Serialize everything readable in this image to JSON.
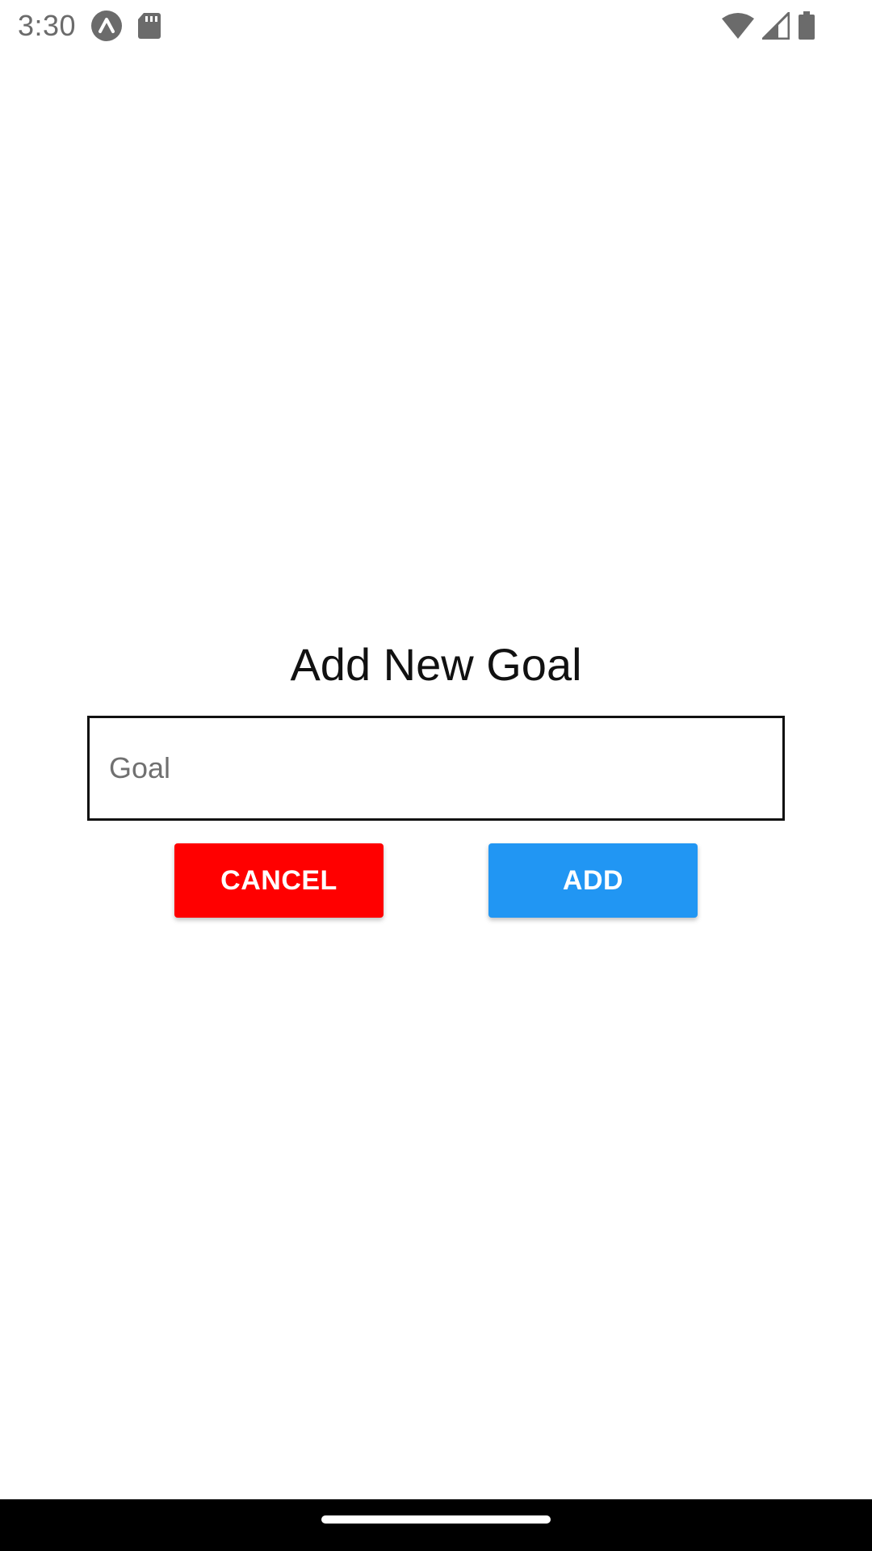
{
  "status_bar": {
    "time": "3:30",
    "icons": [
      "app-notification-icon",
      "sd-card-icon",
      "wifi-icon",
      "cell-signal-icon",
      "battery-icon"
    ]
  },
  "dialog": {
    "title": "Add New Goal",
    "goal_input": {
      "value": "",
      "placeholder": "Goal"
    },
    "cancel_label": "CANCEL",
    "add_label": "ADD"
  },
  "colors": {
    "cancel": "#ff0000",
    "add": "#2196f3",
    "nav_bar": "#000000"
  }
}
